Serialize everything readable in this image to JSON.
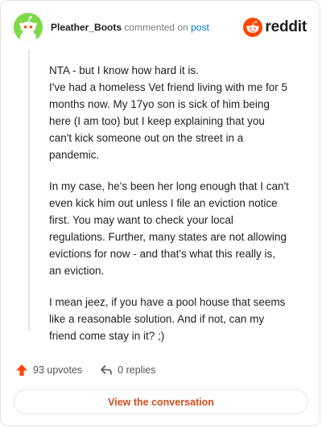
{
  "header": {
    "username": "Pleather_Boots",
    "commented_on": "commented on",
    "post_link": "post",
    "brand": "reddit"
  },
  "comment": {
    "paragraphs": [
      {
        "lines": [
          "NTA - but I know how hard it is.",
          "I've had a homeless Vet friend living with me for 5",
          "months now. My 17yo son is sick of him being",
          "here (I am too) but I keep explaining that you",
          "can't kick someone out on the street in a",
          "pandemic."
        ]
      },
      {
        "lines": [
          "In my case, he's been her long enough that I can't",
          "even kick him out unless I file an eviction notice",
          "first. You may want to check your local",
          "regulations. Further, many states are not allowing",
          "evictions for now - and that's what this really is,",
          "an eviction."
        ]
      },
      {
        "lines": [
          "I mean jeez, if you have a pool house that seems",
          "like a reasonable solution. And if not, can my",
          "friend come stay in it? ;)"
        ]
      }
    ]
  },
  "actions": {
    "upvotes": "93 upvotes",
    "replies": "0 replies",
    "view_conversation": "View the conversation"
  },
  "icons": {
    "avatar": "snoo-avatar-icon",
    "brand_logo": "reddit-logo-icon",
    "upvote": "upvote-arrow-icon",
    "reply": "reply-arrow-icon"
  },
  "colors": {
    "avatar_background": "#7fd94b",
    "brand_orange": "#ff4500",
    "link_blue": "#0079d3",
    "button_text": "#d34c1f"
  }
}
